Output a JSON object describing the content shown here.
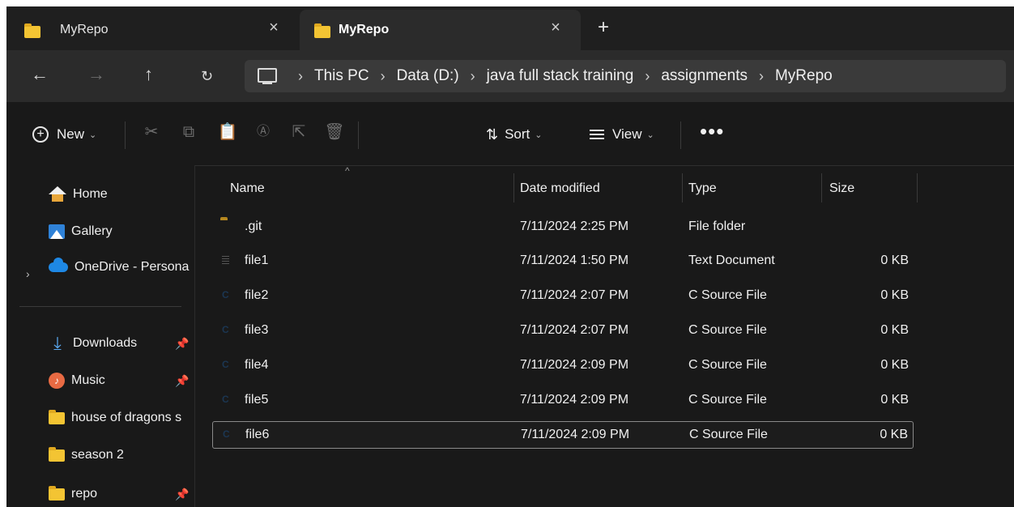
{
  "tabs": [
    {
      "title": "MyRepo",
      "active": false
    },
    {
      "title": "MyRepo",
      "active": true
    }
  ],
  "tab_icons": {
    "close": "×",
    "new_tab": "+"
  },
  "nav": {
    "back": "←",
    "forward": "→",
    "up": "↑",
    "refresh": "C"
  },
  "breadcrumbs": [
    "This PC",
    "Data (D:)",
    "java full stack training",
    "assignments",
    "MyRepo"
  ],
  "breadcrumb_sep": "›",
  "toolbar": {
    "new_label": "New",
    "sort_label": "Sort",
    "view_label": "View",
    "more_label": "•••"
  },
  "sidebar": {
    "items": [
      {
        "label": "Home",
        "icon": "home-icon"
      },
      {
        "label": "Gallery",
        "icon": "gallery-icon"
      },
      {
        "label": "OneDrive - Persona",
        "icon": "onedrive-icon"
      },
      {
        "label": "Downloads",
        "icon": "downloads-icon",
        "pinned": true
      },
      {
        "label": "Music",
        "icon": "music-icon",
        "pinned": true
      },
      {
        "label": "house of dragons s",
        "icon": "folder-icon"
      },
      {
        "label": "season 2",
        "icon": "folder-icon"
      },
      {
        "label": "repo",
        "icon": "folder-icon",
        "pinned": true
      }
    ],
    "pin_glyph": "📌"
  },
  "columns": {
    "name": "Name",
    "date": "Date modified",
    "type": "Type",
    "size": "Size"
  },
  "files": [
    {
      "name": ".git",
      "date": "7/11/2024 2:25 PM",
      "type": "File folder",
      "size": "",
      "icon": "folder-icon"
    },
    {
      "name": "file1",
      "date": "7/11/2024 1:50 PM",
      "type": "Text Document",
      "size": "0 KB",
      "icon": "text-document-icon"
    },
    {
      "name": "file2",
      "date": "7/11/2024 2:07 PM",
      "type": "C Source File",
      "size": "0 KB",
      "icon": "c-source-icon"
    },
    {
      "name": "file3",
      "date": "7/11/2024 2:07 PM",
      "type": "C Source File",
      "size": "0 KB",
      "icon": "c-source-icon"
    },
    {
      "name": "file4",
      "date": "7/11/2024 2:09 PM",
      "type": "C Source File",
      "size": "0 KB",
      "icon": "c-source-icon"
    },
    {
      "name": "file5",
      "date": "7/11/2024 2:09 PM",
      "type": "C Source File",
      "size": "0 KB",
      "icon": "c-source-icon"
    },
    {
      "name": "file6",
      "date": "7/11/2024 2:09 PM",
      "type": "C Source File",
      "size": "0 KB",
      "icon": "c-source-icon",
      "selected": true
    }
  ]
}
